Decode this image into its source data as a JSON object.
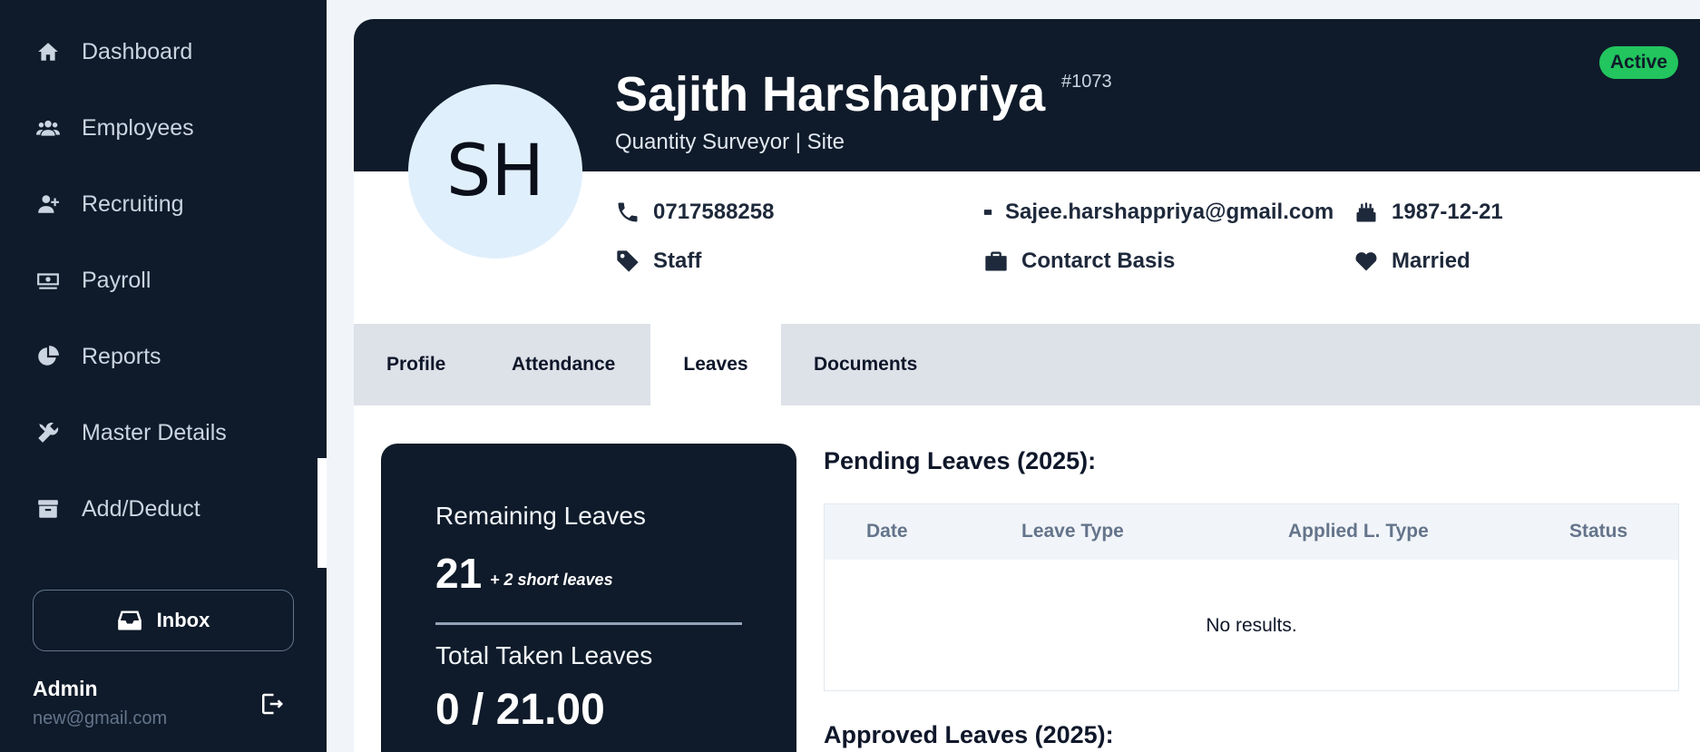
{
  "sidebar": {
    "items": [
      {
        "label": "Dashboard",
        "icon": "home-icon"
      },
      {
        "label": "Employees",
        "icon": "users-icon"
      },
      {
        "label": "Recruiting",
        "icon": "user-plus-icon"
      },
      {
        "label": "Payroll",
        "icon": "money-icon"
      },
      {
        "label": "Reports",
        "icon": "pie-chart-icon"
      },
      {
        "label": "Master Details",
        "icon": "tools-icon"
      },
      {
        "label": "Add/Deduct",
        "icon": "archive-icon"
      }
    ],
    "inbox_label": "Inbox",
    "user": {
      "name": "Admin",
      "email": "new@gmail.com"
    }
  },
  "employee": {
    "initials": "SH",
    "name": "Sajith Harshapriya",
    "id": "#1073",
    "role": "Quantity Surveyor | Site",
    "status": "Active",
    "phone": "0717588258",
    "email": "Sajee.harshappriya@gmail.com",
    "dob": "1987-12-21",
    "category": "Staff",
    "employment_type": "Contarct Basis",
    "marital_status": "Married"
  },
  "tabs": [
    {
      "label": "Profile"
    },
    {
      "label": "Attendance"
    },
    {
      "label": "Leaves"
    },
    {
      "label": "Documents"
    }
  ],
  "active_tab": "Leaves",
  "leaves": {
    "remaining_label": "Remaining Leaves",
    "remaining_value": "21",
    "remaining_extra": "+ 2 short leaves",
    "taken_label": "Total Taken Leaves",
    "taken_value": "0 / 21.00",
    "pending_title": "Pending Leaves (2025):",
    "approved_title": "Approved Leaves (2025):",
    "columns": [
      "Date",
      "Leave Type",
      "Applied L. Type",
      "Status"
    ],
    "empty_text": "No results."
  },
  "colors": {
    "sidebar_bg": "#0f1b2a",
    "status_active": "#22c55e",
    "avatar_bg": "#e0effc"
  }
}
